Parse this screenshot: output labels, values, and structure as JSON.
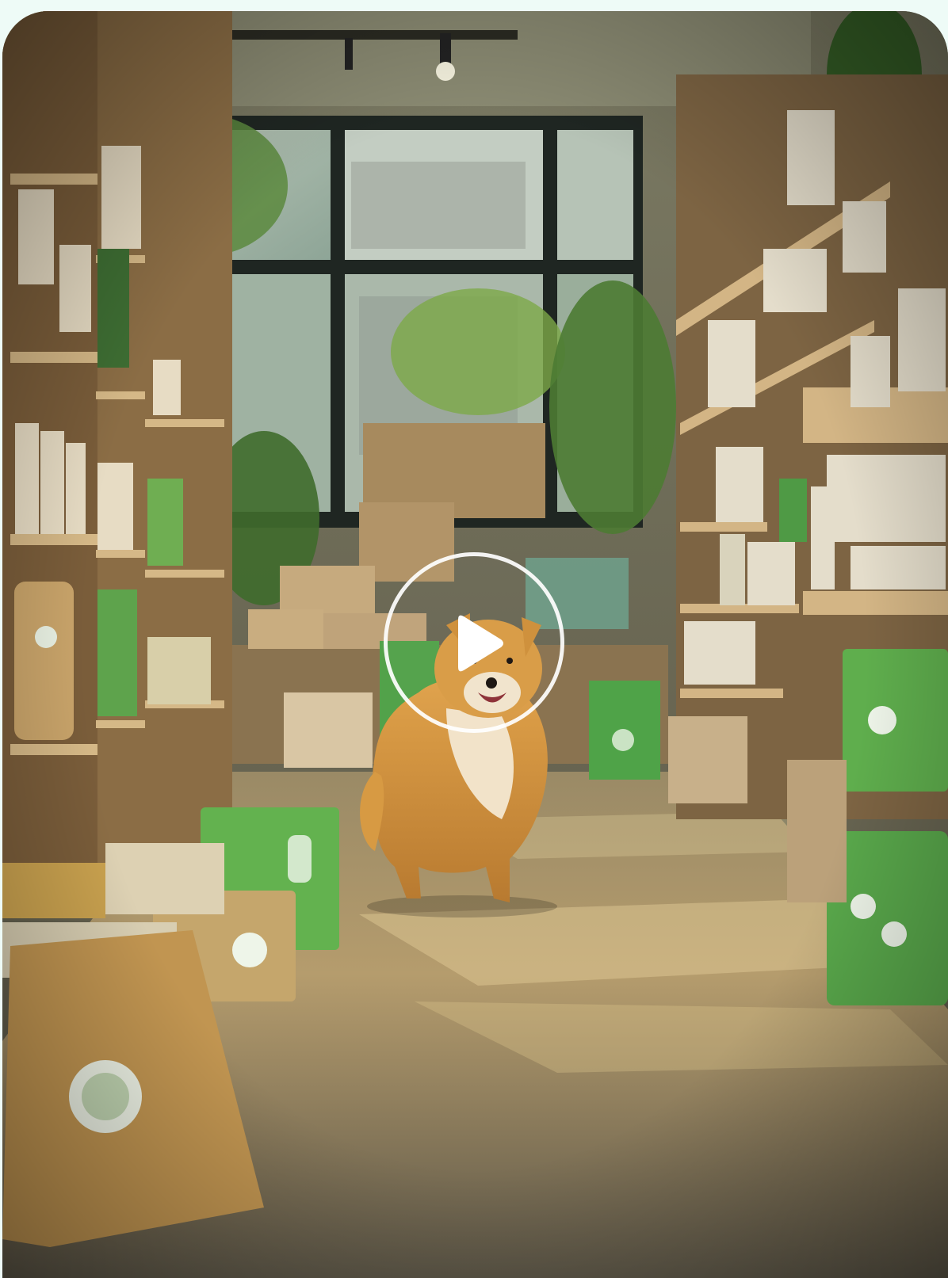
{
  "media": {
    "type": "video-preview",
    "subject": "dog-in-pet-supply-store",
    "play_icon": "play-icon",
    "accent_colors": {
      "background": "#eefbf7",
      "bag_green": "#5fb54a",
      "shelf_wood": "#c9a06a"
    }
  }
}
